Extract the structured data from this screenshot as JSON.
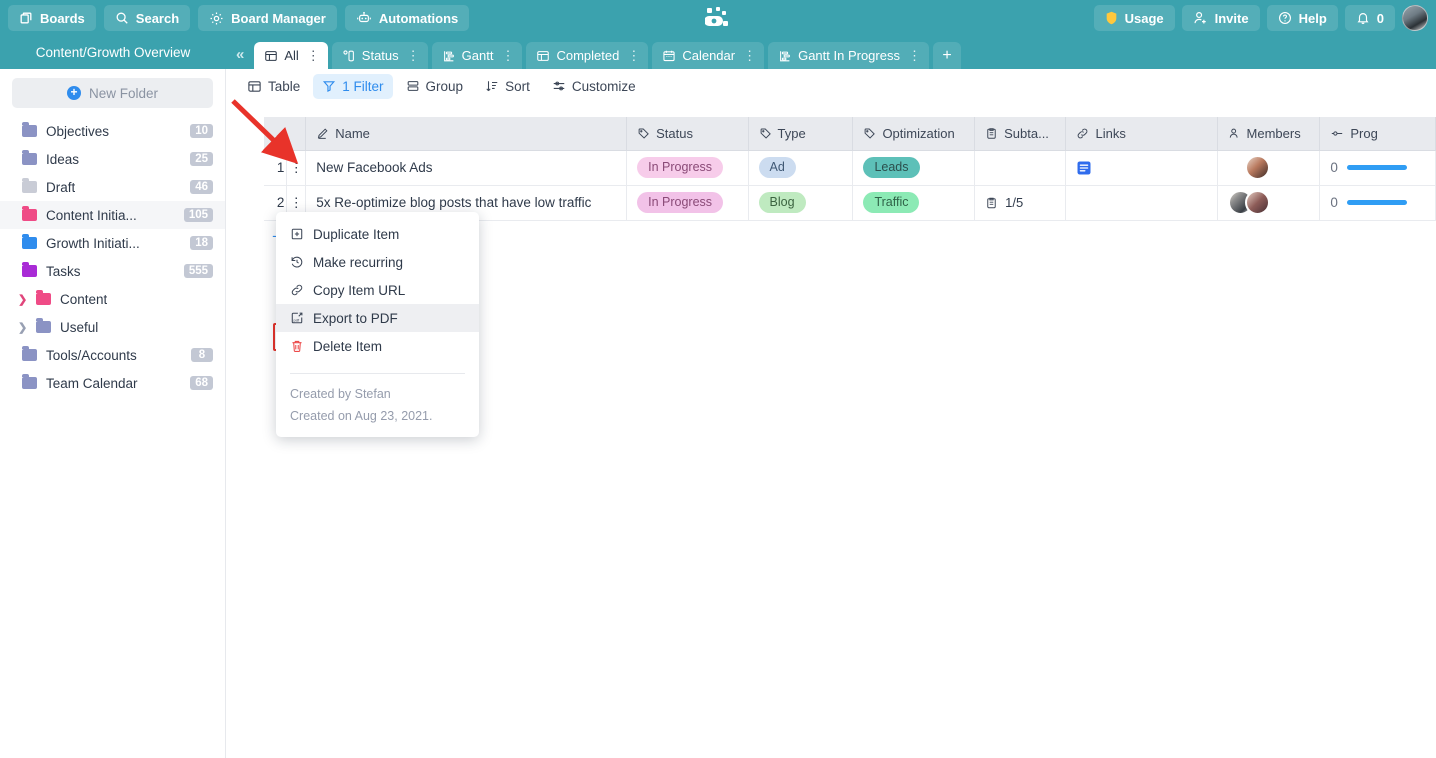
{
  "header": {
    "left_buttons": [
      {
        "label": "Boards",
        "icon": "boards-icon"
      },
      {
        "label": "Search",
        "icon": "search-icon"
      },
      {
        "label": "Board Manager",
        "icon": "gear-icon"
      },
      {
        "label": "Automations",
        "icon": "robot-icon"
      }
    ],
    "right_buttons": [
      {
        "label": "Usage",
        "icon": "shield-icon"
      },
      {
        "label": "Invite",
        "icon": "person-add-icon"
      },
      {
        "label": "Help",
        "icon": "question-circle-icon"
      }
    ],
    "notifications_count": "0",
    "logo": "app-logo",
    "brand_color": "#3ba2ae"
  },
  "board": {
    "title": "Content/Growth Overview",
    "tabs": [
      {
        "label": "All",
        "icon": "table-icon",
        "active": true
      },
      {
        "label": "Status",
        "icon": "status-icon",
        "active": false
      },
      {
        "label": "Gantt",
        "icon": "gantt-icon",
        "active": false
      },
      {
        "label": "Completed",
        "icon": "table-icon",
        "active": false
      },
      {
        "label": "Calendar",
        "icon": "calendar-icon",
        "active": false
      },
      {
        "label": "Gantt In Progress",
        "icon": "gantt-icon",
        "active": false
      }
    ],
    "add_tab_label": "+"
  },
  "sidebar": {
    "new_folder_label": "New Folder",
    "items": [
      {
        "label": "Objectives",
        "count": "10",
        "color": "#8b93c4",
        "expandable": false,
        "selected": false
      },
      {
        "label": "Ideas",
        "count": "25",
        "color": "#8b93c4",
        "expandable": false,
        "selected": false
      },
      {
        "label": "Draft",
        "count": "46",
        "color": "#c9ccd6",
        "expandable": false,
        "selected": false
      },
      {
        "label": "Content Initia...",
        "count": "105",
        "color": "#ef4b86",
        "expandable": false,
        "selected": true
      },
      {
        "label": "Growth Initiati...",
        "count": "18",
        "color": "#2f8ced",
        "expandable": false,
        "selected": false
      },
      {
        "label": "Tasks",
        "count": "555",
        "color": "#a92bd6",
        "expandable": false,
        "selected": false
      },
      {
        "label": "Content",
        "count": "",
        "color": "#ef4b86",
        "expandable": true,
        "selected": false
      },
      {
        "label": "Useful",
        "count": "",
        "color": "#8b93c4",
        "expandable": true,
        "selected": false
      },
      {
        "label": "Tools/Accounts",
        "count": "8",
        "color": "#8b93c4",
        "expandable": false,
        "selected": false
      },
      {
        "label": "Team Calendar",
        "count": "68",
        "color": "#8b93c4",
        "expandable": false,
        "selected": false
      }
    ]
  },
  "toolbar": {
    "buttons": [
      {
        "label": "Table",
        "icon": "table-icon",
        "active": false
      },
      {
        "label": "1 Filter",
        "icon": "filter-icon",
        "active": true
      },
      {
        "label": "Group",
        "icon": "group-icon",
        "active": false
      },
      {
        "label": "Sort",
        "icon": "sort-icon",
        "active": false
      },
      {
        "label": "Customize",
        "icon": "customize-icon",
        "active": false
      }
    ]
  },
  "table": {
    "columns": [
      {
        "label": "Name",
        "icon": "pencil-icon"
      },
      {
        "label": "Status",
        "icon": "tag-icon"
      },
      {
        "label": "Type",
        "icon": "tag-icon"
      },
      {
        "label": "Optimization",
        "icon": "tag-icon"
      },
      {
        "label": "Subta...",
        "icon": "clipboard-icon"
      },
      {
        "label": "Links",
        "icon": "link-icon"
      },
      {
        "label": "Members",
        "icon": "people-icon"
      },
      {
        "label": "Prog",
        "icon": "slider-icon"
      }
    ],
    "rows": [
      {
        "index": "1",
        "name": "New Facebook Ads",
        "status": "In Progress",
        "status_bg": "#f7ccea",
        "status_fg": "#8a4a77",
        "type": "Ad",
        "type_bg": "#ccdcf0",
        "type_fg": "#3f5875",
        "optimization": "Leads",
        "opt_bg": "#5dc0b8",
        "opt_fg": "#2c4f4d",
        "subtasks": "",
        "has_link": true,
        "progress": "0"
      },
      {
        "index": "2",
        "name": "5x Re-optimize blog posts that have low traffic",
        "status": "In Progress",
        "status_bg": "#f2c2e8",
        "status_fg": "#8a4a77",
        "type": "Blog",
        "type_bg": "#bfeac0",
        "type_fg": "#3b6340",
        "optimization": "Traffic",
        "opt_bg": "#8ceab5",
        "opt_fg": "#2f6348",
        "subtasks": "1/5",
        "has_link": false,
        "progress": "0"
      }
    ],
    "add_row_label": "+"
  },
  "context_menu": {
    "items": [
      {
        "label": "Duplicate Item",
        "icon": "duplicate-icon",
        "highlighted": false
      },
      {
        "label": "Make recurring",
        "icon": "recurring-icon",
        "highlighted": false
      },
      {
        "label": "Copy Item URL",
        "icon": "link-icon",
        "highlighted": false
      },
      {
        "label": "Export to PDF",
        "icon": "export-pdf-icon",
        "highlighted": true
      },
      {
        "label": "Delete Item",
        "icon": "trash-icon",
        "highlighted": false
      }
    ],
    "created_by": "Created by Stefan",
    "created_on": "Created on Aug 23, 2021."
  },
  "annotation": {
    "highlight_color": "#e8332a",
    "target": "Export to PDF"
  }
}
